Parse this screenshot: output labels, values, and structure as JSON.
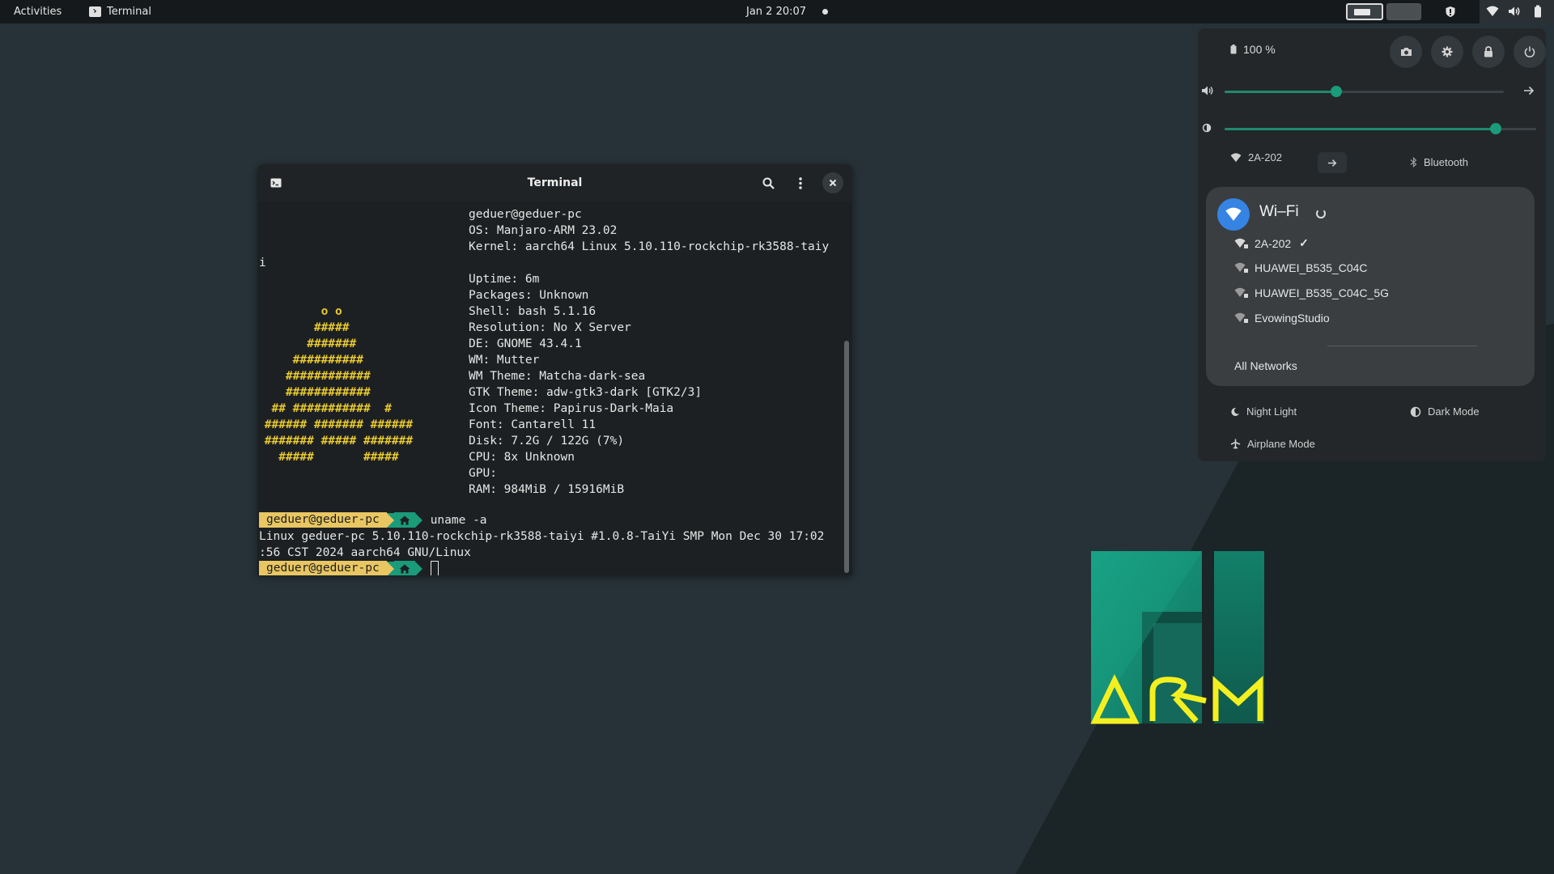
{
  "topbar": {
    "activities": "Activities",
    "app_name": "Terminal",
    "clock": "Jan 2  20:07"
  },
  "terminal": {
    "title": "Terminal",
    "neofetch_header": "geduer@geduer-pc",
    "info_lines": [
      "OS: Manjaro-ARM 23.02",
      "Kernel: aarch64 Linux 5.10.110-rockchip-rk3588-taiy",
      "Uptime: 6m",
      "Packages: Unknown",
      "Shell: bash 5.1.16",
      "Resolution: No X Server",
      "DE: GNOME 43.4.1",
      "WM: Mutter",
      "WM Theme: Matcha-dark-sea",
      "GTK Theme: adw-gtk3-dark [GTK2/3]",
      "Icon Theme: Papirus-Dark-Maia",
      "Font: Cantarell 11",
      "Disk: 7.2G / 122G (7%)",
      "CPU: 8x Unknown",
      "GPU:",
      "RAM: 984MiB / 15916MiB"
    ],
    "kernel_wrap": "i",
    "ascii_art": [
      "         o o",
      "        #####",
      "       #######",
      "     ##########",
      "    ############",
      "    ############",
      "  ## ###########  #",
      " ###### ####### ######",
      " ####### ##### #######",
      "   #####       #####"
    ],
    "prompt_user": "geduer@geduer-pc",
    "command": "uname -a",
    "output_line1": "Linux geduer-pc 5.10.110-rockchip-rk3588-taiyi #1.0.8-TaiYi SMP Mon Dec 30 17:02",
    "output_line2": ":56 CST 2024 aarch64 GNU/Linux",
    "prompt_user2": "geduer@geduer-pc"
  },
  "quick_settings": {
    "battery": "100 %",
    "volume_level": 0.4,
    "brightness_level": 0.87,
    "wifi_toggle_label": "2A-202",
    "bluetooth_label": "Bluetooth",
    "wifi_menu": {
      "title": "Wi–Fi",
      "networks": [
        {
          "name": "2A-202",
          "connected": true
        },
        {
          "name": "HUAWEI_B535_C04C",
          "connected": false
        },
        {
          "name": "HUAWEI_B535_C04C_5G",
          "connected": false
        },
        {
          "name": "EvowingStudio",
          "connected": false
        }
      ],
      "all_networks": "All Networks",
      "check_mark": "✓"
    },
    "night_light": "Night Light",
    "dark_mode": "Dark Mode",
    "airplane_mode": "Airplane Mode"
  },
  "colors": {
    "accent": "#1a9b7a",
    "prompt_user_bg": "#e8c662",
    "ascii": "#e8c92f",
    "wifi_blue": "#3584e4",
    "logo_yellow": "#f4f020"
  },
  "icons": [
    "terminal-icon",
    "search-icon",
    "kebab-menu-icon",
    "close-icon",
    "new-tab-icon",
    "battery-icon",
    "screenshot-icon",
    "settings-icon",
    "lock-icon",
    "power-icon",
    "volume-icon",
    "brightness-icon",
    "wifi-icon",
    "arrow-right-icon",
    "bluetooth-icon",
    "night-light-icon",
    "dark-mode-icon",
    "airplane-icon",
    "home-icon",
    "lock-small-icon"
  ]
}
